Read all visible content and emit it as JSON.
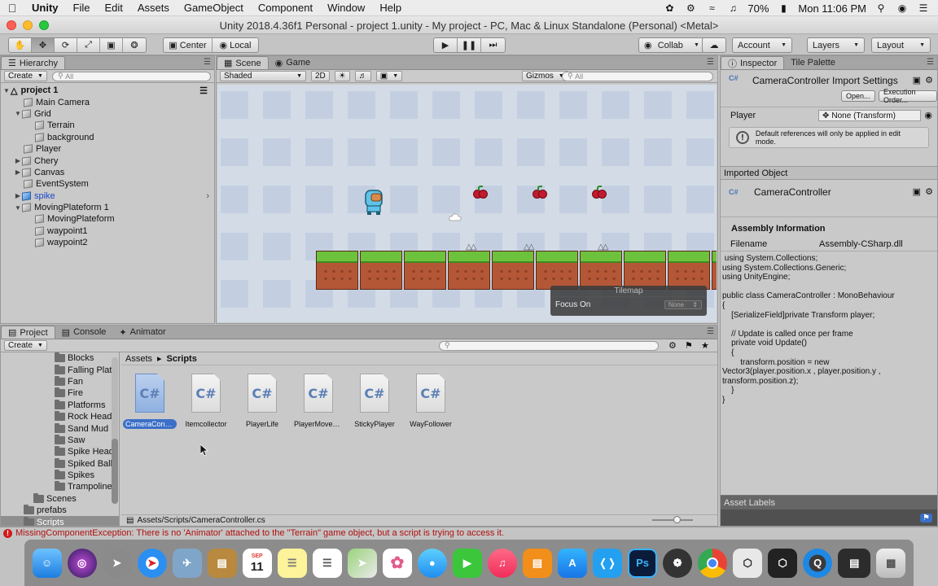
{
  "menubar": {
    "app_name": "Unity",
    "items": [
      "File",
      "Edit",
      "Assets",
      "GameObject",
      "Component",
      "Window",
      "Help"
    ],
    "battery": "70%",
    "clock": "Mon 11:06 PM"
  },
  "window": {
    "title": "Unity 2018.4.36f1 Personal - project 1.unity - My project - PC, Mac & Linux Standalone (Personal) <Metal>"
  },
  "toolbar": {
    "pivot": "Center",
    "space": "Local",
    "collab": "Collab",
    "account": "Account",
    "layers": "Layers",
    "layout": "Layout"
  },
  "hierarchy": {
    "tab": "Hierarchy",
    "create": "Create",
    "search_placeholder": "All",
    "items": [
      {
        "label": "project 1"
      },
      {
        "label": "Main Camera"
      },
      {
        "label": "Grid"
      },
      {
        "label": "Terrain"
      },
      {
        "label": "background"
      },
      {
        "label": "Player"
      },
      {
        "label": "Chery"
      },
      {
        "label": "Canvas"
      },
      {
        "label": "EventSystem"
      },
      {
        "label": "spike"
      },
      {
        "label": "MovingPlateform 1"
      },
      {
        "label": "MovingPlateform"
      },
      {
        "label": "waypoint1"
      },
      {
        "label": "waypoint2"
      }
    ]
  },
  "scene": {
    "tab_scene": "Scene",
    "tab_game": "Game",
    "shading": "Shaded",
    "mode_2d": "2D",
    "gizmos": "Gizmos",
    "search_placeholder": "All",
    "tilemap_title": "Tilemap",
    "focus_label": "Focus On",
    "focus_value": "None"
  },
  "project": {
    "tab_project": "Project",
    "tab_console": "Console",
    "tab_animator": "Animator",
    "create": "Create",
    "tree": [
      {
        "label": "Blocks"
      },
      {
        "label": "Falling Plat"
      },
      {
        "label": "Fan"
      },
      {
        "label": "Fire"
      },
      {
        "label": "Platforms"
      },
      {
        "label": "Rock Head"
      },
      {
        "label": "Sand Mud I"
      },
      {
        "label": "Saw"
      },
      {
        "label": "Spike Head"
      },
      {
        "label": "Spiked Ball"
      },
      {
        "label": "Spikes"
      },
      {
        "label": "Trampoline"
      },
      {
        "label": "Scenes"
      },
      {
        "label": "prefabs"
      },
      {
        "label": "Scripts"
      }
    ],
    "breadcrumb": {
      "root": "Assets",
      "current": "Scripts"
    },
    "assets": [
      {
        "label": "CameraContr..."
      },
      {
        "label": "Itemcollector"
      },
      {
        "label": "PlayerLife"
      },
      {
        "label": "PlayerMovem..."
      },
      {
        "label": "StickyPlayer"
      },
      {
        "label": "WayFollower"
      }
    ],
    "csharp_glyph": "C#",
    "path": "Assets/Scripts/CameraController.cs"
  },
  "inspector": {
    "tab_inspector": "Inspector",
    "tab_tile_palette": "Tile Palette",
    "title": "CameraController Import Settings",
    "open_button": "Open...",
    "exec_order_button": "Execution Order...",
    "player_label": "Player",
    "player_value": "None (Transform)",
    "help_text": "Default references will only be applied in edit mode.",
    "imported_object": "Imported Object",
    "object_name": "CameraController",
    "assembly_title": "Assembly Information",
    "filename_label": "Filename",
    "filename_value": "Assembly-CSharp.dll",
    "code": " using System.Collections;\nusing System.Collections.Generic;\nusing UnityEngine;\n\npublic class CameraController : MonoBehaviour\n{\n    [SerializeField]private Transform player;\n\n    // Update is called once per frame\n    private void Update()\n    {\n        transform.position = new\nVector3(player.position.x , player.position.y ,\ntransform.position.z);\n    }\n}",
    "asset_labels": "Asset Labels"
  },
  "status": {
    "message": "MissingComponentException: There is no 'Animator' attached to the \"Terrain\" game object, but a script is trying to access it."
  },
  "dock": {
    "calendar_month": "SEP",
    "calendar_day": "11",
    "ps_label": "Ps"
  },
  "colors": {
    "selection_blue": "#3b6fc8",
    "error_red": "#d11b1b",
    "grass_green": "#6cc23d",
    "dirt_brown": "#b45737"
  }
}
